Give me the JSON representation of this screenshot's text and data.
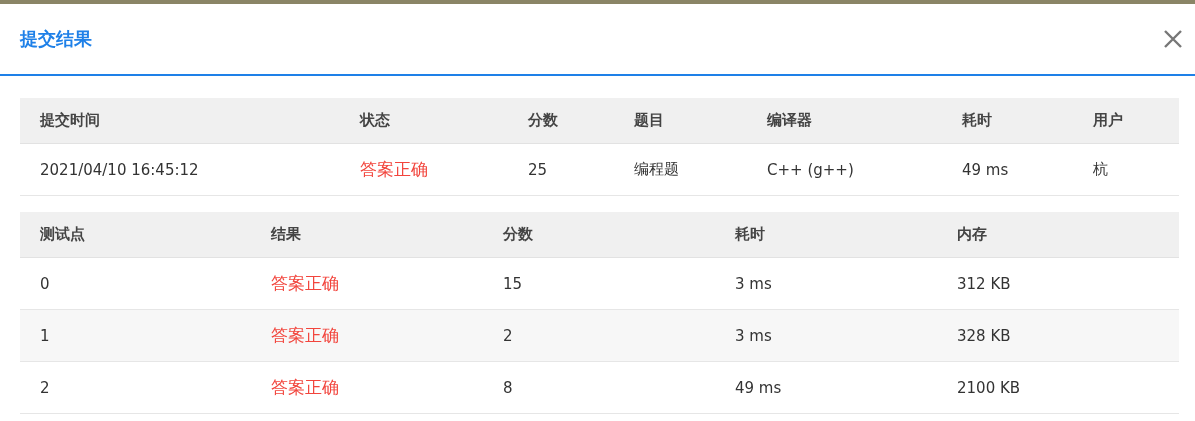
{
  "dialog": {
    "title": "提交结果"
  },
  "submission_table": {
    "columns": [
      "提交时间",
      "状态",
      "分数",
      "题目",
      "编译器",
      "耗时",
      "用户"
    ],
    "rows": [
      [
        "2021/04/10 16:45:12",
        "答案正确",
        "25",
        "编程题",
        "C++ (g++)",
        "49 ms",
        "杭"
      ]
    ]
  },
  "testcase_table": {
    "columns": [
      "测试点",
      "结果",
      "分数",
      "耗时",
      "内存"
    ],
    "rows": [
      [
        "0",
        "答案正确",
        "15",
        "3 ms",
        "312 KB"
      ],
      [
        "1",
        "答案正确",
        "2",
        "3 ms",
        "328 KB"
      ],
      [
        "2",
        "答案正确",
        "8",
        "49 ms",
        "2100 KB"
      ]
    ]
  }
}
